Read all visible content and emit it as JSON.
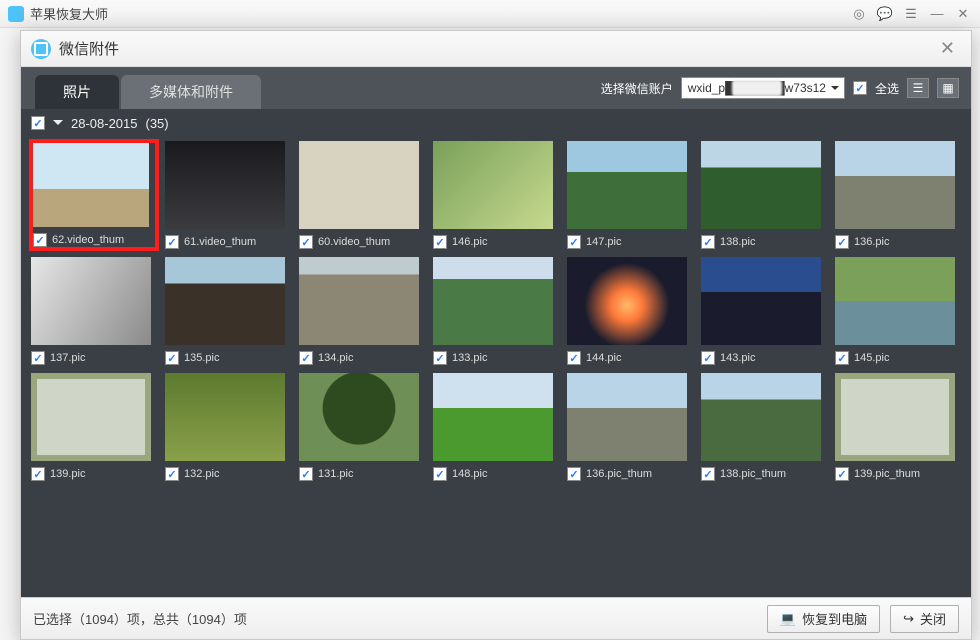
{
  "app": {
    "title": "苹果恢复大师"
  },
  "modal": {
    "title": "微信附件"
  },
  "tabs": {
    "photos": "照片",
    "media": "多媒体和附件"
  },
  "toolbar": {
    "select_account_label": "选择微信账户",
    "account_value": "wxid_p███████w73s12",
    "select_all": "全选"
  },
  "group": {
    "date": "28-08-2015",
    "count": "(35)"
  },
  "items": {
    "r0": [
      {
        "label": "62.video_thum",
        "cls": "sky",
        "hl": true
      },
      {
        "label": "61.video_thum",
        "cls": "dark"
      },
      {
        "label": "60.video_thum",
        "cls": "paper"
      },
      {
        "label": "146.pic",
        "cls": "flowers"
      },
      {
        "label": "147.pic",
        "cls": "mtn"
      },
      {
        "label": "138.pic",
        "cls": "mtn2"
      },
      {
        "label": "136.pic",
        "cls": "jeep"
      }
    ],
    "r1": [
      {
        "label": "137.pic",
        "cls": "water"
      },
      {
        "label": "135.pic",
        "cls": "gate"
      },
      {
        "label": "134.pic",
        "cls": "rocks"
      },
      {
        "label": "133.pic",
        "cls": "valley"
      },
      {
        "label": "144.pic",
        "cls": "sunset"
      },
      {
        "label": "143.pic",
        "cls": "sunset2"
      },
      {
        "label": "145.pic",
        "cls": "river"
      }
    ],
    "r2": [
      {
        "label": "139.pic",
        "cls": "sign"
      },
      {
        "label": "132.pic",
        "cls": "grass"
      },
      {
        "label": "131.pic",
        "cls": "tree"
      },
      {
        "label": "148.pic",
        "cls": "field"
      },
      {
        "label": "136.pic_thum",
        "cls": "jeep"
      },
      {
        "label": "138.pic_thum",
        "cls": "hill"
      },
      {
        "label": "139.pic_thum",
        "cls": "sign"
      }
    ]
  },
  "footer": {
    "status": "已选择（1094）项，总共（1094）项",
    "restore": "恢复到电脑",
    "close": "关闭"
  }
}
